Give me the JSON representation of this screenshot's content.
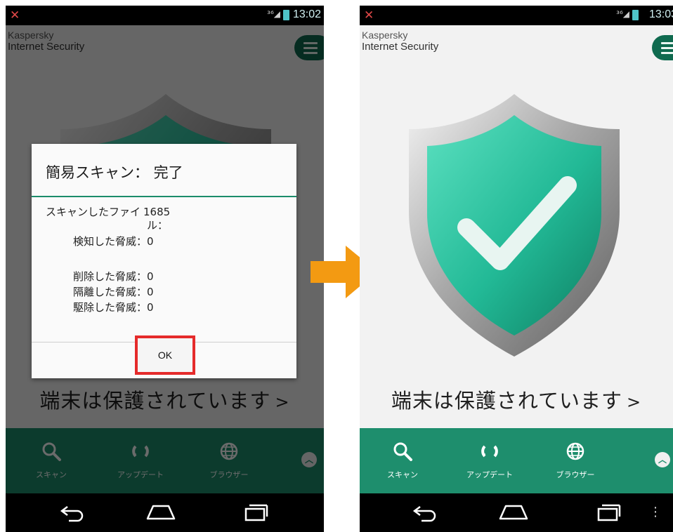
{
  "status_bar": {
    "signal": "³⁶◢",
    "time_left": "13:02",
    "time_right": "13:03"
  },
  "app": {
    "brand_line1": "Kaspersky",
    "brand_line2": "Internet Security"
  },
  "protected_status": {
    "text": "端末は保護されています",
    "arrow": ">"
  },
  "bottom_nav": {
    "items": [
      {
        "label": "スキャン",
        "icon": "search-icon"
      },
      {
        "label": "アップデート",
        "icon": "refresh-icon"
      },
      {
        "label": "ブラウザー",
        "icon": "globe-icon"
      }
    ]
  },
  "scan_dialog": {
    "title": "簡易スキャン： 完了",
    "scanned_files_label_line1": "スキャンしたファイ",
    "scanned_files_label_line2": "ル：",
    "scanned_files_value": "1685",
    "detected_label": "検知した脅威：",
    "detected_value": "0",
    "deleted_label": "削除した脅威：",
    "deleted_value": "0",
    "quarantined_label": "隔離した脅威：",
    "quarantined_value": "0",
    "removed_label": "駆除した脅威：",
    "removed_value": "0",
    "ok_label": "OK"
  },
  "colors": {
    "accent_green": "#1e8e6d",
    "menu_green": "#0f6a4f",
    "highlight_red": "#e52b2b",
    "arrow_orange": "#f39a12"
  }
}
